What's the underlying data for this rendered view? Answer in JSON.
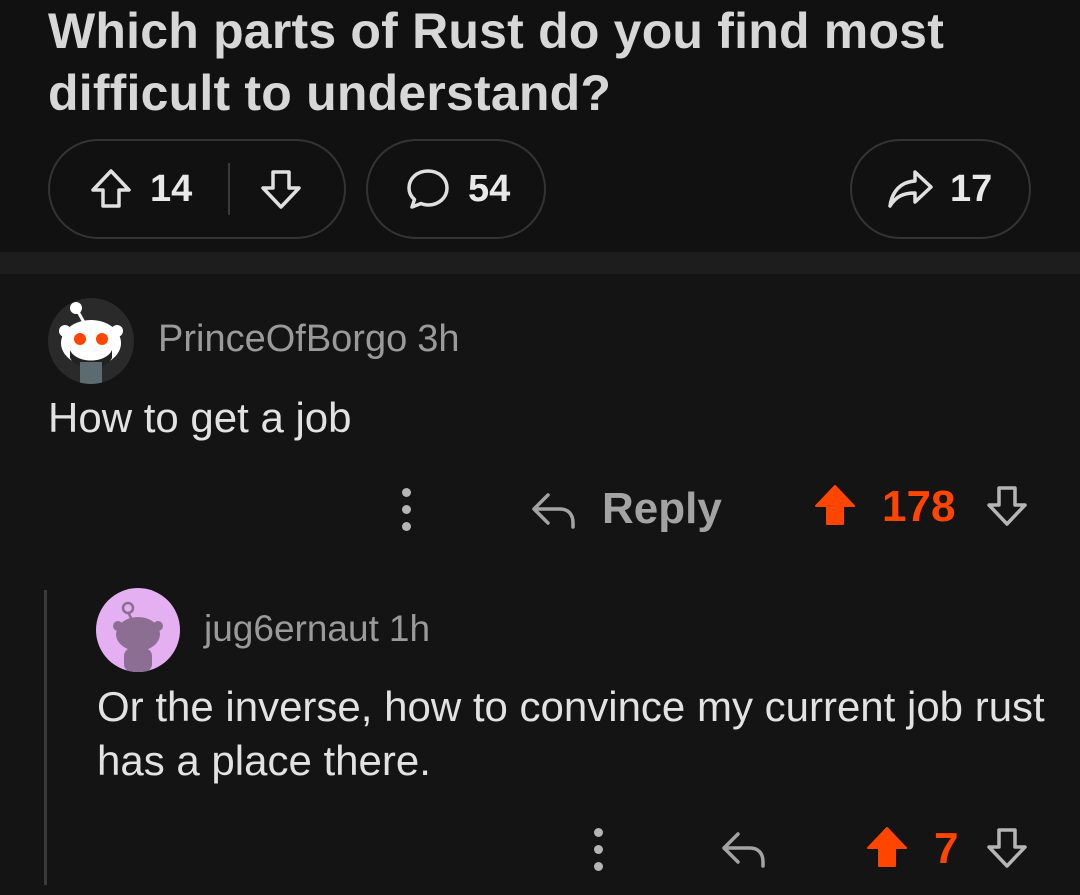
{
  "post": {
    "title": "Which parts of Rust do you find most difficult to understand?",
    "upvotes": "14",
    "comments": "54",
    "shares": "17"
  },
  "comment1": {
    "author": "PrinceOfBorgo",
    "time": "3h",
    "body": "How to get a job",
    "reply_label": "Reply",
    "score": "178"
  },
  "comment2": {
    "author": "jug6ernaut",
    "time": "1h",
    "body": "Or the inverse, how to convince my current job rust has a place there.",
    "score": "7"
  },
  "colors": {
    "accent": "#ff4500",
    "background": "#111111",
    "avatar2_bg": "#e4b0f2"
  },
  "icons": {
    "upvote": "arrow-up-outline-icon",
    "downvote": "arrow-down-outline-icon",
    "comments": "speech-bubble-icon",
    "share": "share-arrow-icon",
    "reply": "reply-arrow-icon",
    "more": "vertical-dots-icon",
    "upvote_active": "arrow-up-filled-icon"
  }
}
